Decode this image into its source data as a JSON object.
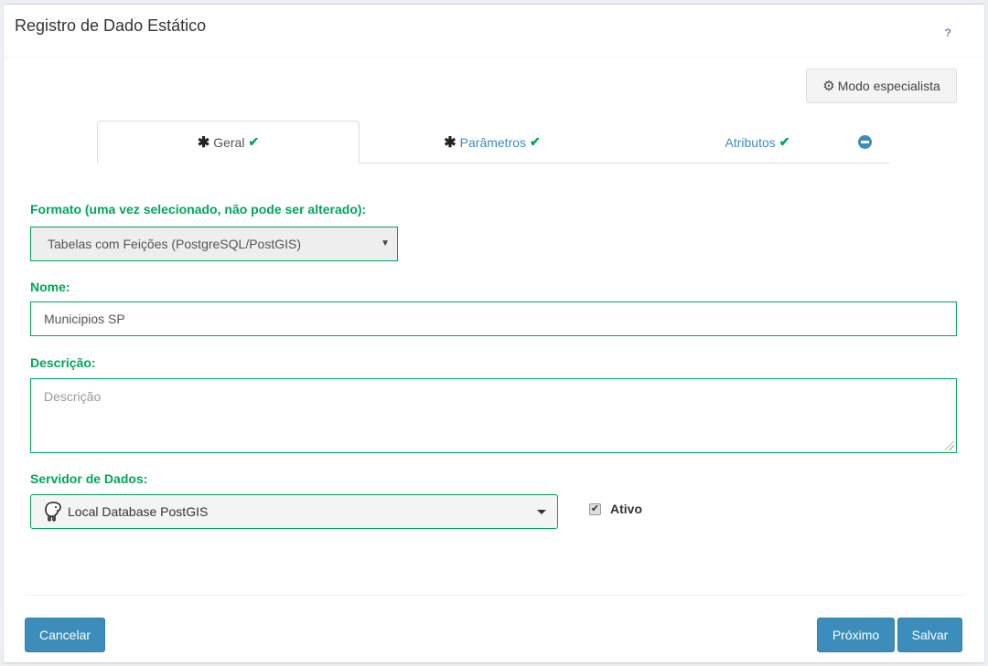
{
  "header": {
    "title": "Registro de Dado Estático",
    "help_label": "?"
  },
  "toolbar": {
    "expert_mode_label": "Modo especialista",
    "expert_icon": "gear-icon"
  },
  "tabs": [
    {
      "label": "Geral",
      "required": true,
      "valid": true,
      "active": true
    },
    {
      "label": "Parâmetros",
      "required": true,
      "valid": true,
      "active": false
    },
    {
      "label": "Atributos",
      "required": false,
      "valid": true,
      "active": false
    }
  ],
  "form": {
    "format": {
      "label": "Formato (uma vez selecionado, não pode ser alterado):",
      "value": "Tabelas com Feições (PostgreSQL/PostGIS)"
    },
    "name": {
      "label": "Nome:",
      "value": "Municipios SP"
    },
    "description": {
      "label": "Descrição:",
      "placeholder": "Descrição",
      "value": ""
    },
    "server": {
      "label": "Servidor de Dados:",
      "value": "Local Database PostGIS",
      "icon": "postgresql-elephant-icon"
    },
    "active": {
      "label": "Ativo",
      "checked": true
    }
  },
  "footer": {
    "cancel_label": "Cancelar",
    "next_label": "Próximo",
    "save_label": "Salvar"
  },
  "colors": {
    "accent": "#3c8dbc",
    "valid": "#00a65a"
  }
}
